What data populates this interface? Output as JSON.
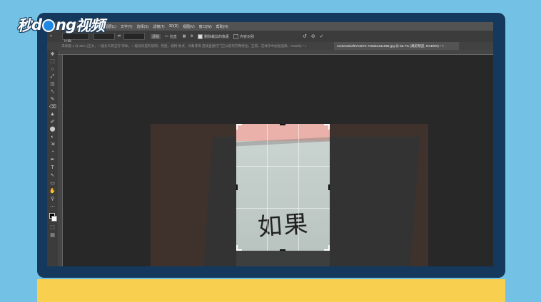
{
  "logo": {
    "part1": "秒",
    "part2": "d",
    "part3": "ng",
    "part4": "视频"
  },
  "menu": [
    "图像(I)",
    "图层(L)",
    "文字(Y)",
    "选择(S)",
    "滤镜(T)",
    "3D(D)",
    "视图(V)",
    "窗口(W)",
    "帮助(H)"
  ],
  "options": {
    "ratio_select": "比例",
    "swap_icon": "⇄",
    "clear_button": "清除",
    "straighten_label": "拉直",
    "delete_pixels_checkbox": "删除裁剪的像素",
    "content_aware_checkbox": "内容识别",
    "reset_icon": "↺",
    "cancel_icon": "⊘",
    "commit_icon": "✓"
  },
  "tabs": {
    "tab1": "未标题-1 @ 25% (正文，一般为三到五行 宋体，一般号码是的说明，然后，结构 地点，对象等等 后续直接打门卫以前的写用标注；正常，这样示中此框选择，RGB/8) *  ×",
    "tab2": "4ed1011b2f07c6972 7e8abe4a1596.jpg @ 66.7% (裁剪预览, RGB/8#) *  ×"
  },
  "tools": [
    "✥",
    "⬚",
    "○",
    "⤢",
    "⊡",
    "⤣",
    "✎",
    "⌫",
    "▲",
    "✐",
    "⬤",
    "◐",
    "⇲",
    "T",
    "↖",
    "▭",
    "✋",
    "⚲",
    "⋯",
    "■",
    "⬚",
    "▤"
  ],
  "document": {
    "handwriting": "如果"
  }
}
